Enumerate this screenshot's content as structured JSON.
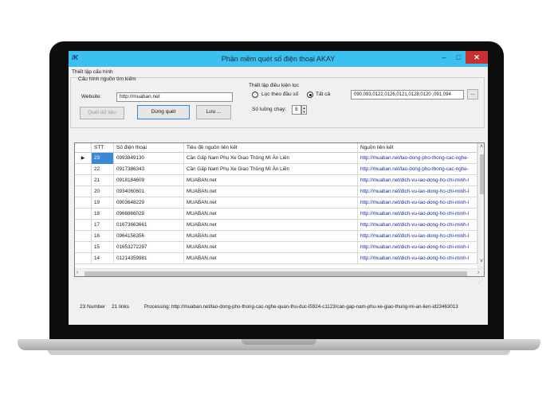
{
  "app": {
    "icon_label": "/K",
    "title": "Phần mềm quét số điện thoại AKAY",
    "minimize": "–",
    "maximize": "□",
    "close": "✕"
  },
  "config": {
    "section_title": "Thiết lập cấu hình",
    "source_title": "Cấu hình nguồn tìm kiếm",
    "website_label": "Website:",
    "website_value": "http://muaban.net",
    "buttons": {
      "scan": "Quét dữ liệu",
      "stop": "Dừng quét",
      "save": "Lưu ..."
    },
    "filter_title": "Thiết lập điều kiện lọc",
    "filter_prefix_label": "Lọc theo đầu số",
    "filter_all_label": "Tất cả",
    "filter_selected": "all",
    "prefixes_value": "090,093,0122,0126,0121,0128,0120 ,091,094",
    "browse_label": "...",
    "threads_label": "Số luồng chạy:",
    "threads_value": "8"
  },
  "grid": {
    "columns": [
      "STT",
      "Số điện thoại",
      "Tiêu đề nguồn liên kết",
      "Nguồn liên kết"
    ],
    "current_row_marker": "▶",
    "rows": [
      {
        "stt": "23",
        "phone": "0993849130",
        "title": "Cần Gấp Nam Phụ Xe Giao Thủng Mì Ăn Liền",
        "url": "http://muaban.net/lao-dong-pho-thong-cac-nghe-"
      },
      {
        "stt": "22",
        "phone": "0917386343",
        "title": "Cần Gấp Nam Phụ Xe Giao Thủng Mì Ăn Liền",
        "url": "http://muaban.net/lao-dong-pho-thong-cac-nghe-"
      },
      {
        "stt": "21",
        "phone": "0918184609",
        "title": "MUABAN.net",
        "url": "http://muaban.net/dich-vu-lao-dong-ho-chi-minh-l"
      },
      {
        "stt": "20",
        "phone": "0934060601",
        "title": "MUABAN.net",
        "url": "http://muaban.net/dich-vu-lao-dong-ho-chi-minh-l"
      },
      {
        "stt": "19",
        "phone": "0903648229",
        "title": "MUABAN.net",
        "url": "http://muaban.net/dich-vu-lao-dong-ho-chi-minh-l"
      },
      {
        "stt": "18",
        "phone": "0966866029",
        "title": "MUABAN.net",
        "url": "http://muaban.net/dich-vu-lao-dong-ho-chi-minh-l"
      },
      {
        "stt": "17",
        "phone": "01673663661",
        "title": "MUABAN.net",
        "url": "http://muaban.net/dich-vu-lao-dong-ho-chi-minh-l"
      },
      {
        "stt": "16",
        "phone": "0964156356",
        "title": "MUABAN.net",
        "url": "http://muaban.net/dich-vu-lao-dong-ho-chi-minh-l"
      },
      {
        "stt": "15",
        "phone": "01653272297",
        "title": "MUABAN.net",
        "url": "http://muaban.net/dich-vu-lao-dong-ho-chi-minh-l"
      },
      {
        "stt": "14",
        "phone": "01214359981",
        "title": "MUABAN.net",
        "url": "http://muaban.net/dich-vu-lao-dong-ho-chi-minh-l"
      }
    ]
  },
  "status": {
    "numbers": "23 Number",
    "links": "21 links",
    "processing": "Processing: http://muaban.net/lao-dong-pho-thong-cac-nghe-quan-thu-duc-l5924-c1123/can-gap-nam-phu-xe-giao-thung-mi-an-lien-id23463013"
  },
  "colors": {
    "titlebar": "#3cc0f0",
    "close": "#c7312f",
    "selection": "#3b88d8",
    "link": "#1a2ba0"
  }
}
